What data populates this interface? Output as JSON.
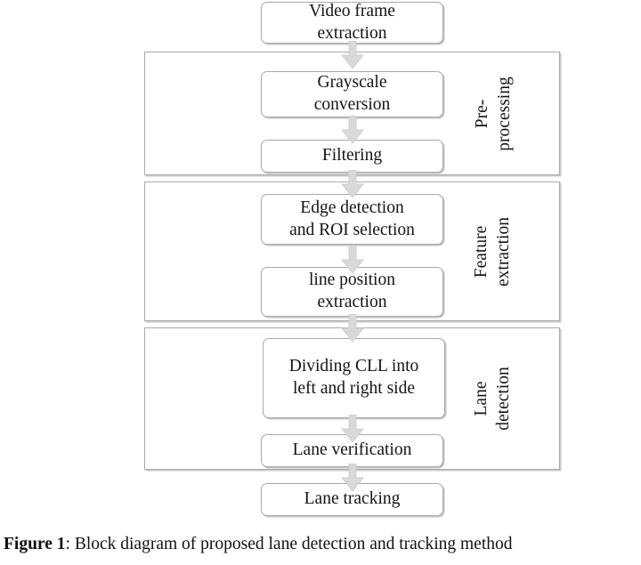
{
  "figure": {
    "caption_label": "Figure 1",
    "caption_separator": ": ",
    "caption_text": "Block diagram of proposed lane detection and tracking method"
  },
  "colors": {
    "box_border": "#a9a9a9",
    "group_border": "#a9a9a9",
    "arrow_fill": "#d9d9d9",
    "arrow_stroke": "#cccccc",
    "text": "#141414",
    "background": "#ffffff"
  },
  "diagram": {
    "type": "flowchart",
    "title": "Block diagram of proposed lane detection and tracking method",
    "nodes": [
      {
        "id": "video-frame-extraction",
        "label": "Video frame\nextraction",
        "group": null
      },
      {
        "id": "grayscale-conversion",
        "label": "Grayscale\nconversion",
        "group": "pre-processing"
      },
      {
        "id": "filtering",
        "label": "Filtering",
        "group": "pre-processing"
      },
      {
        "id": "edge-detection-roi-selection",
        "label": "Edge detection\nand ROI selection",
        "group": "feature-extraction"
      },
      {
        "id": "line-position-extraction",
        "label": "line position\nextraction",
        "group": "feature-extraction"
      },
      {
        "id": "dividing-cll",
        "label": "Dividing CLL into\nleft and right side",
        "group": "lane-detection"
      },
      {
        "id": "lane-verification",
        "label": "Lane verification",
        "group": "lane-detection"
      },
      {
        "id": "lane-tracking",
        "label": "Lane tracking",
        "group": null
      }
    ],
    "groups": [
      {
        "id": "pre-processing",
        "label": "Pre-\nprocessing"
      },
      {
        "id": "feature-extraction",
        "label": "Feature\nextraction"
      },
      {
        "id": "lane-detection",
        "label": "Lane\ndetection"
      }
    ],
    "edges": [
      {
        "from": "video-frame-extraction",
        "to": "grayscale-conversion"
      },
      {
        "from": "grayscale-conversion",
        "to": "filtering"
      },
      {
        "from": "filtering",
        "to": "edge-detection-roi-selection"
      },
      {
        "from": "edge-detection-roi-selection",
        "to": "line-position-extraction"
      },
      {
        "from": "line-position-extraction",
        "to": "dividing-cll"
      },
      {
        "from": "dividing-cll",
        "to": "lane-verification"
      },
      {
        "from": "lane-verification",
        "to": "lane-tracking"
      }
    ]
  }
}
